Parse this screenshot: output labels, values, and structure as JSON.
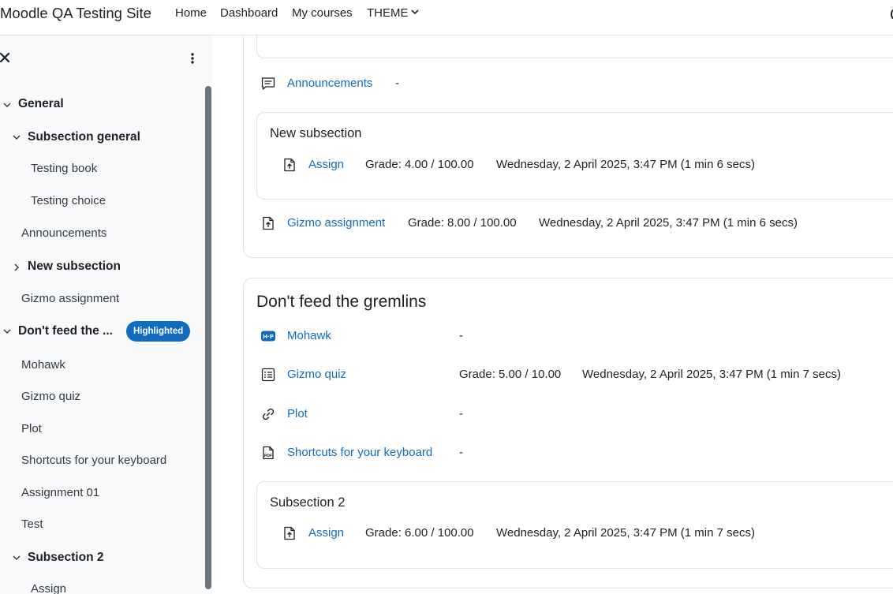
{
  "navbar": {
    "site_name": "Moodle QA Testing Site",
    "links": [
      "Home",
      "Dashboard",
      "My courses",
      "THEME"
    ]
  },
  "drawer": {
    "items": [
      {
        "label": "General"
      },
      {
        "label": "Subsection general"
      },
      {
        "label": "Testing book"
      },
      {
        "label": "Testing choice"
      },
      {
        "label": "Announcements"
      },
      {
        "label": "New subsection"
      },
      {
        "label": "Gizmo assignment"
      },
      {
        "label": "Don't feed the ..."
      },
      {
        "label": "Mohawk"
      },
      {
        "label": "Gizmo quiz"
      },
      {
        "label": "Plot"
      },
      {
        "label": "Shortcuts for your keyboard"
      },
      {
        "label": "Assignment 01"
      },
      {
        "label": "Test"
      },
      {
        "label": "Subsection 2"
      },
      {
        "label": "Assign"
      }
    ],
    "badge": "Highlighted"
  },
  "main": {
    "section1": {
      "announcements": {
        "name": "Announcements",
        "status": "-"
      },
      "new_subsection": {
        "title": "New subsection",
        "assign": {
          "name": "Assign",
          "grade": "Grade: 4.00 / 100.00",
          "date": "Wednesday, 2 April 2025, 3:47 PM (1 min 6 secs)"
        }
      },
      "gizmo_assignment": {
        "name": "Gizmo assignment",
        "grade": "Grade: 8.00 / 100.00",
        "date": "Wednesday, 2 April 2025, 3:47 PM (1 min 6 secs)"
      }
    },
    "section2": {
      "title": "Don't feed the gremlins",
      "mohawk": {
        "name": "Mohawk",
        "status": "-"
      },
      "gizmo_quiz": {
        "name": "Gizmo quiz",
        "grade": "Grade: 5.00 / 10.00",
        "date": "Wednesday, 2 April 2025, 3:47 PM (1 min 7 secs)"
      },
      "plot": {
        "name": "Plot",
        "status": "-"
      },
      "shortcuts": {
        "name": "Shortcuts for your keyboard",
        "status": "-"
      },
      "subsection2": {
        "title": "Subsection 2",
        "assign": {
          "name": "Assign",
          "grade": "Grade: 6.00 / 100.00",
          "date": "Wednesday, 2 April 2025, 3:47 PM (1 min 7 secs)"
        }
      }
    }
  },
  "icons": {
    "forum": "forum-icon",
    "assign": "assign-icon",
    "h5p": "h5p-icon",
    "quiz": "quiz-icon",
    "url": "link-icon",
    "pdf": "pdf-icon"
  },
  "colors": {
    "link": "#0f6cbf",
    "badge": "#0f6cbf",
    "drawer_bg": "#f8f9fa",
    "border": "#dee2e6"
  }
}
